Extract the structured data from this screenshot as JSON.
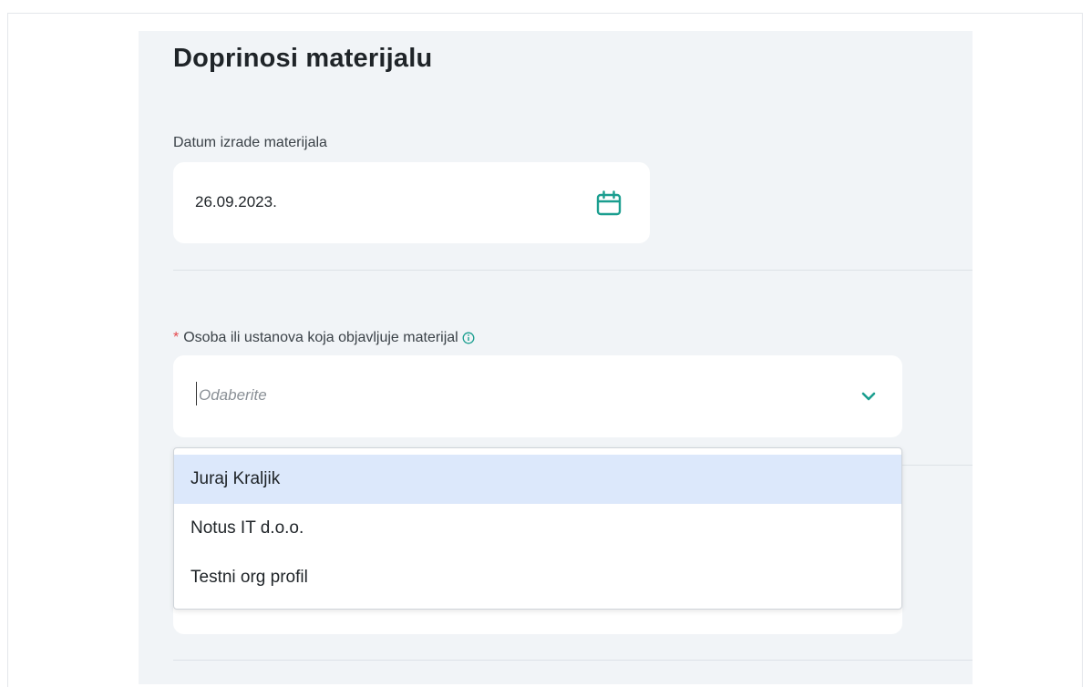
{
  "section": {
    "title": "Doprinosi materijalu"
  },
  "date_field": {
    "label": "Datum izrade materijala",
    "value": "26.09.2023.",
    "icon": "calendar-icon"
  },
  "publisher_field": {
    "required_mark": "*",
    "label": "Osoba ili ustanova koja objavljuje materijal",
    "placeholder": "Odaberite",
    "info_icon": "info-icon",
    "dropdown_icon": "chevron-down-icon",
    "options": [
      {
        "label": "Juraj Kraljik",
        "highlighted": true
      },
      {
        "label": "Notus IT d.o.o.",
        "highlighted": false
      },
      {
        "label": "Testni org profil",
        "highlighted": false
      }
    ]
  },
  "colors": {
    "accent": "#1a9e8f",
    "panel_bg": "#f1f4f7",
    "highlight": "#dce8fb",
    "required": "#e5484d"
  }
}
